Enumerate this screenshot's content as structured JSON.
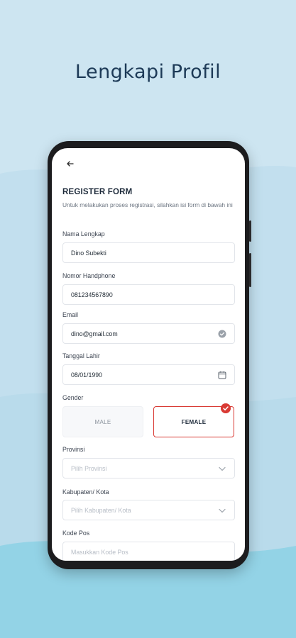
{
  "headline": "Lengkapi Profil",
  "colors": {
    "background": "#cfe6f2",
    "accent": "#d93a34",
    "title": "#1d3a57"
  },
  "app": {
    "back_icon": "arrow-left-icon",
    "form_title": "REGISTER FORM",
    "form_subtitle": "Untuk melakukan proses registrasi, silahkan isi form di bawah ini",
    "fields": {
      "name": {
        "label": "Nama Lengkap",
        "value": "Dino Subekti"
      },
      "phone": {
        "label": "Nomor Handphone",
        "value": "081234567890"
      },
      "email": {
        "label": "Email",
        "value": "dino@gmail.com",
        "icon": "verified-check-icon"
      },
      "birthdate": {
        "label": "Tanggal Lahir",
        "value": "08/01/1990",
        "icon": "calendar-icon"
      },
      "gender": {
        "label": "Gender",
        "options": [
          "MALE",
          "FEMALE"
        ],
        "selected": "FEMALE",
        "selected_icon": "check-badge-icon"
      },
      "province": {
        "label": "Provinsi",
        "placeholder": "Pilih Provinsi",
        "icon": "chevron-down-icon"
      },
      "city": {
        "label": "Kabupaten/ Kota",
        "placeholder": "Pilih Kabupaten/ Kota",
        "icon": "chevron-down-icon"
      },
      "postal": {
        "label": "Kode Pos",
        "placeholder": "Masukkan Kode Pos"
      }
    }
  }
}
